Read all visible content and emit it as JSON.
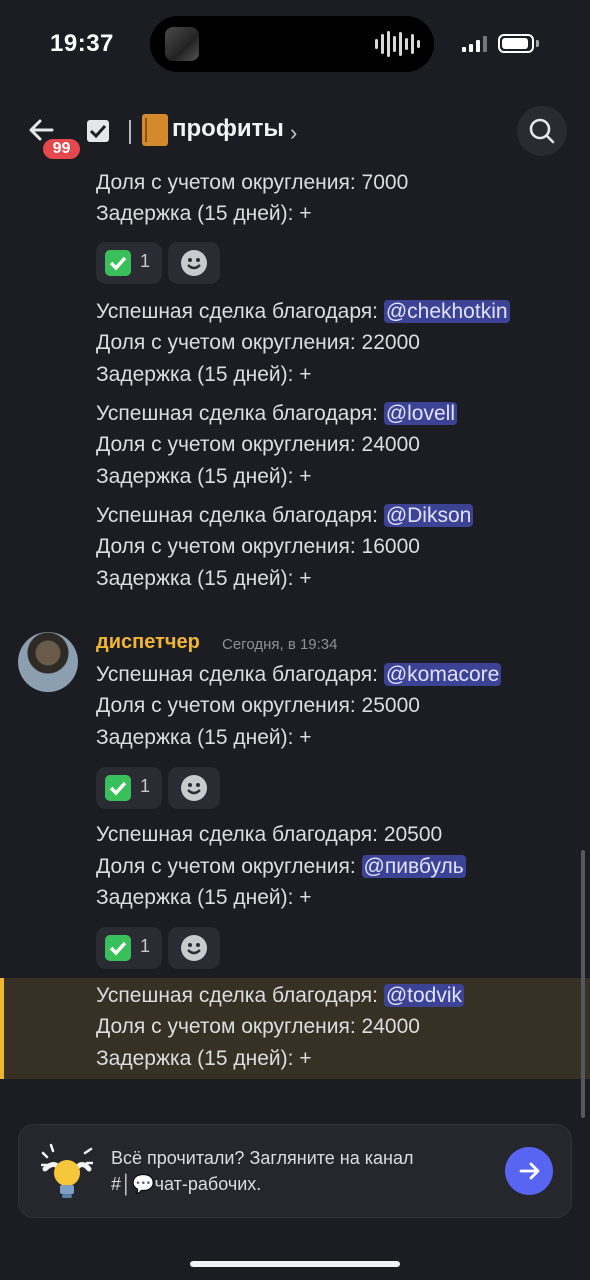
{
  "status_bar": {
    "time": "19:37"
  },
  "header": {
    "notification_count": "99",
    "channel_name": "профиты",
    "chevron": "›"
  },
  "messages": [
    {
      "lines": [
        "Доля с учетом округления: 7000",
        "Задержка (15  дней): +"
      ]
    },
    {
      "lines": [
        "Успешная сделка благодаря: ",
        "Доля с учетом округления:  22000",
        "Задержка (15  дней): +"
      ],
      "mention": "@chekhotkin"
    },
    {
      "lines": [
        "Успешная сделка благодаря: ",
        "Доля с учетом округления:  24000",
        "Задержка (15  дней): +"
      ],
      "mention": "@lovell"
    },
    {
      "lines": [
        "Успешная сделка благодаря: ",
        "Доля с учетом округления: 16000",
        "Задержка (15  дней): +"
      ],
      "mention": "@Dikson"
    },
    {
      "lines": [
        "Успешная сделка благодаря: ",
        "Доля с учетом округления:  25000",
        "Задержка (15  дней): +"
      ],
      "mention": "@komacore"
    },
    {
      "lines": [
        "Успешная сделка благодаря: 20500",
        "Доля с учетом округления: ",
        "Задержка (15  дней): +"
      ],
      "mention": "@пивбуль"
    },
    {
      "lines": [
        "Успешная сделка благодаря: ",
        "Доля с учетом округления:  24000",
        "Задержка (15  дней): +"
      ],
      "mention": "@todvik"
    }
  ],
  "author": {
    "name": "диспетчер",
    "timestamp": "Сегодня, в 19:34"
  },
  "reactions": {
    "count": "1"
  },
  "banner": {
    "text_line1": "Всё прочитали? Загляните на канал",
    "text_line2": "#│💬чат-рабочих."
  },
  "colors": {
    "accent": "#5865f2",
    "author": "#f0b532",
    "mention_bg": "#3c4394",
    "badge": "#e5484d"
  },
  "icons": [
    "back-arrow-icon",
    "thread-icon",
    "channel-book-icon",
    "search-icon",
    "check-mark-emoji-icon",
    "add-reaction-icon",
    "lightbulb-icon",
    "arrow-right-icon"
  ]
}
